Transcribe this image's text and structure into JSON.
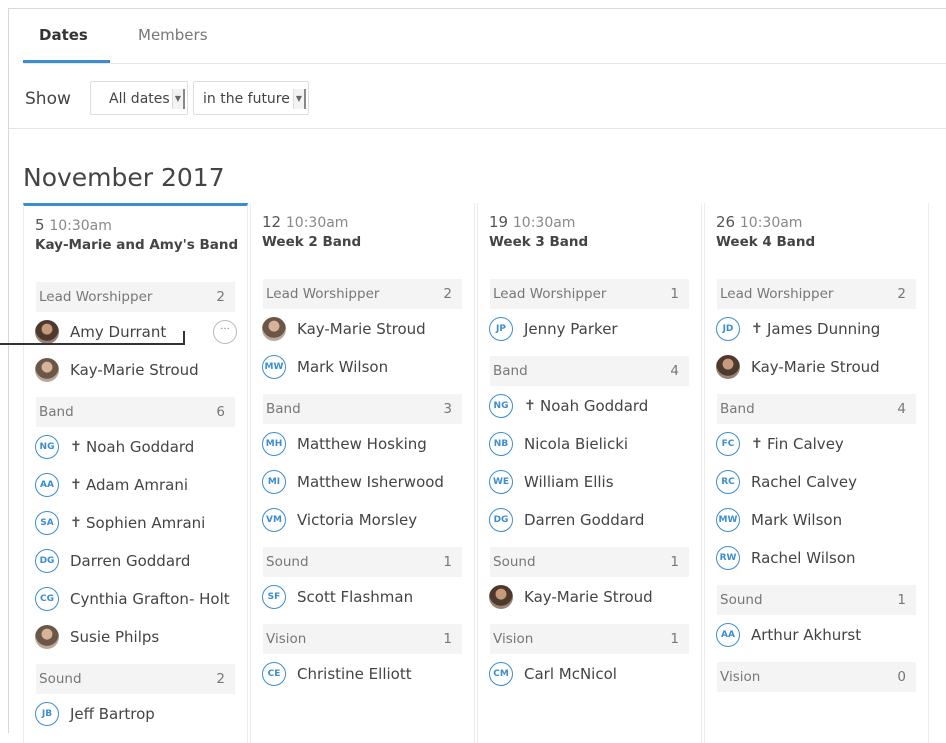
{
  "tabs": {
    "dates": "Dates",
    "members": "Members"
  },
  "filter": {
    "show_label": "Show",
    "dates_value": "All dates",
    "when_value": "in the future"
  },
  "month": "November 2017",
  "accent": "#3c8dcf",
  "columns": [
    {
      "day": "5",
      "time": "10:30am",
      "event": "Kay-Marie and Amy's Band",
      "groups": [
        {
          "label": "Lead Worshipper",
          "count": "2",
          "people": [
            {
              "initials": "",
              "name": "Amy Durrant",
              "photo": true
            },
            {
              "initials": "",
              "name": "Kay-Marie Stroud",
              "photo": true
            }
          ]
        },
        {
          "label": "Band",
          "count": "6",
          "people": [
            {
              "initials": "NG",
              "name": "Noah Goddard",
              "leader": true
            },
            {
              "initials": "AA",
              "name": "Adam Amrani",
              "leader": true
            },
            {
              "initials": "SA",
              "name": "Sophien Amrani",
              "leader": true
            },
            {
              "initials": "DG",
              "name": "Darren Goddard"
            },
            {
              "initials": "CG",
              "name": "Cynthia Grafton- Holt"
            },
            {
              "initials": "",
              "name": "Susie Philps",
              "photo": true
            }
          ]
        },
        {
          "label": "Sound",
          "count": "2",
          "people": [
            {
              "initials": "JB",
              "name": "Jeff Bartrop"
            }
          ]
        }
      ]
    },
    {
      "day": "12",
      "time": "10:30am",
      "event": "Week 2 Band",
      "groups": [
        {
          "label": "Lead Worshipper",
          "count": "2",
          "people": [
            {
              "initials": "",
              "name": "Kay-Marie Stroud",
              "photo": true
            },
            {
              "initials": "MW",
              "name": "Mark Wilson"
            }
          ]
        },
        {
          "label": "Band",
          "count": "3",
          "people": [
            {
              "initials": "MH",
              "name": "Matthew Hosking"
            },
            {
              "initials": "MI",
              "name": "Matthew Isherwood"
            },
            {
              "initials": "VM",
              "name": "Victoria Morsley"
            }
          ]
        },
        {
          "label": "Sound",
          "count": "1",
          "people": [
            {
              "initials": "SF",
              "name": "Scott Flashman"
            }
          ]
        },
        {
          "label": "Vision",
          "count": "1",
          "people": [
            {
              "initials": "CE",
              "name": "Christine Elliott"
            }
          ]
        }
      ]
    },
    {
      "day": "19",
      "time": "10:30am",
      "event": "Week 3 Band",
      "groups": [
        {
          "label": "Lead Worshipper",
          "count": "1",
          "people": [
            {
              "initials": "JP",
              "name": "Jenny Parker"
            }
          ]
        },
        {
          "label": "Band",
          "count": "4",
          "people": [
            {
              "initials": "NG",
              "name": "Noah Goddard",
              "leader": true
            },
            {
              "initials": "NB",
              "name": "Nicola Bielicki"
            },
            {
              "initials": "WE",
              "name": "William Ellis"
            },
            {
              "initials": "DG",
              "name": "Darren Goddard"
            }
          ]
        },
        {
          "label": "Sound",
          "count": "1",
          "people": [
            {
              "initials": "",
              "name": "Kay-Marie Stroud",
              "photo": true
            }
          ]
        },
        {
          "label": "Vision",
          "count": "1",
          "people": [
            {
              "initials": "CM",
              "name": "Carl McNicol"
            }
          ]
        }
      ]
    },
    {
      "day": "26",
      "time": "10:30am",
      "event": "Week 4 Band",
      "groups": [
        {
          "label": "Lead Worshipper",
          "count": "2",
          "people": [
            {
              "initials": "JD",
              "name": "James Dunning",
              "leader": true
            },
            {
              "initials": "",
              "name": "Kay-Marie Stroud",
              "photo": true
            }
          ]
        },
        {
          "label": "Band",
          "count": "4",
          "people": [
            {
              "initials": "FC",
              "name": "Fin Calvey",
              "leader": true
            },
            {
              "initials": "RC",
              "name": "Rachel Calvey"
            },
            {
              "initials": "MW",
              "name": "Mark Wilson"
            },
            {
              "initials": "RW",
              "name": "Rachel Wilson"
            }
          ]
        },
        {
          "label": "Sound",
          "count": "1",
          "people": [
            {
              "initials": "AA",
              "name": "Arthur Akhurst"
            }
          ]
        },
        {
          "label": "Vision",
          "count": "0",
          "people": []
        }
      ]
    }
  ]
}
